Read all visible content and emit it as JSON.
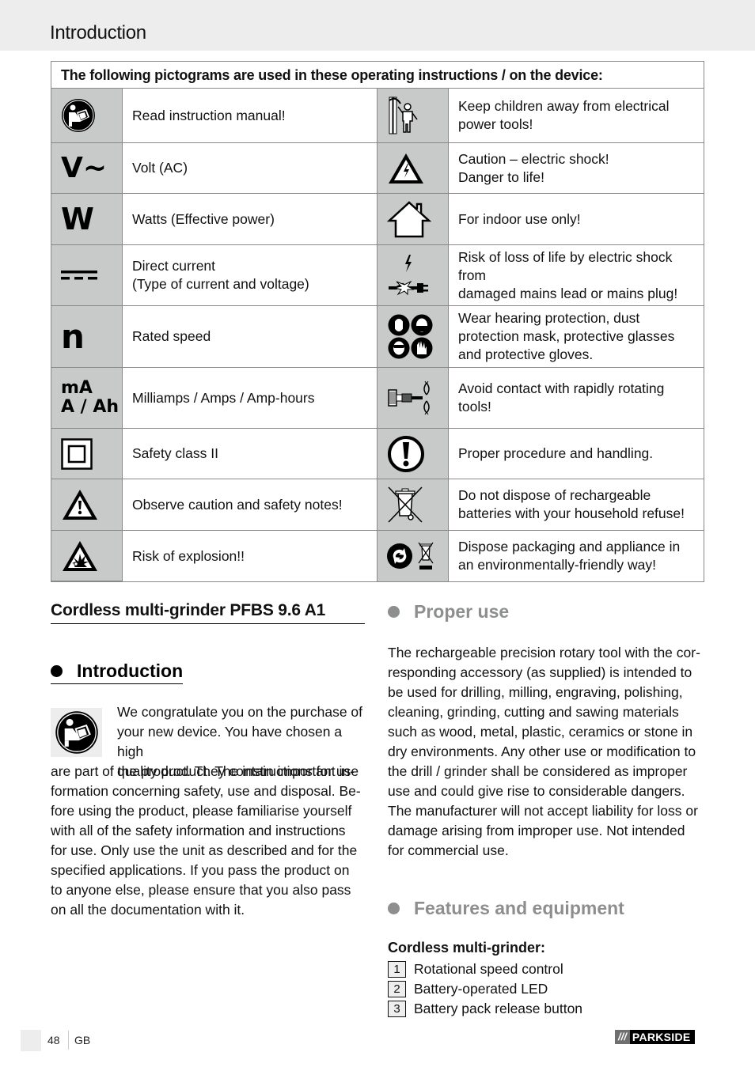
{
  "header": {
    "title": "Introduction"
  },
  "pictogram_table": {
    "caption": "The following pictograms are used in these operating instructions / on the device:",
    "rows": [
      {
        "left": {
          "icon": "read-manual-icon",
          "text": "Read instruction manual!"
        },
        "right": {
          "icon": "keep-children-away-icon",
          "text": "Keep children away from electrical\npower tools!"
        }
      },
      {
        "left": {
          "icon": "volt-ac-symbol",
          "symbol": "V~",
          "text": "Volt (AC)"
        },
        "right": {
          "icon": "electric-shock-warning-icon",
          "text": "Caution – electric shock!\nDanger to life!"
        }
      },
      {
        "left": {
          "icon": "watts-symbol",
          "symbol": "W",
          "text": "Watts (Effective power)"
        },
        "right": {
          "icon": "house-indoor-icon",
          "text": "For indoor use only!"
        }
      },
      {
        "left": {
          "icon": "direct-current-icon",
          "text": "Direct current\n(Type of current and voltage)"
        },
        "right": {
          "icon": "damaged-plug-shock-icon",
          "text": "Risk of loss of life by electric shock from\ndamaged mains lead or mains plug!"
        }
      },
      {
        "left": {
          "icon": "rated-speed-symbol",
          "symbol": "n",
          "text": "Rated speed"
        },
        "right": {
          "icon": "protective-equipment-icon",
          "text": "Wear hearing protection, dust\nprotection mask, protective glasses\nand protective gloves."
        }
      },
      {
        "left": {
          "icon": "amps-symbol",
          "symbol_line1": "mA",
          "symbol_line2": "A / Ah",
          "text": "Milliamps / Amps / Amp-hours"
        },
        "right": {
          "icon": "rotating-tool-icon",
          "text": "Avoid contact with rapidly rotating\ntools!"
        }
      },
      {
        "left": {
          "icon": "safety-class-ii-icon",
          "text": "Safety class II"
        },
        "right": {
          "icon": "exclamation-circle-icon",
          "text": "Proper procedure and handling."
        }
      },
      {
        "left": {
          "icon": "caution-triangle-icon",
          "text": "Observe caution and safety notes!"
        },
        "right": {
          "icon": "crossed-bin-icon",
          "text": "Do not dispose of rechargeable\nbatteries with your household refuse!"
        }
      },
      {
        "left": {
          "icon": "explosion-warning-icon",
          "text": "Risk of explosion!!"
        },
        "right": {
          "icon": "recycle-dispose-icon",
          "text": "Dispose packaging and appliance in\nan environmentally-friendly way!"
        }
      }
    ]
  },
  "left_column": {
    "product_title": "Cordless multi-grinder PFBS 9.6 A1",
    "intro_heading": "Introduction",
    "intro_text_lines": [
      "We congratulate you on the purchase of",
      "your new device. You have chosen a high",
      "quality product. The instructions for use",
      "are part of the product. They contain important in-",
      "formation concerning safety, use and disposal. Be-",
      "fore using the product, please familiarise yourself",
      "with all of the safety information and instructions",
      "for use. Only use the unit as described and for the",
      "specified applications. If you pass the product on",
      "to anyone else, please ensure that you also pass",
      "on all the documentation with it."
    ]
  },
  "right_column": {
    "proper_use_heading": "Proper use",
    "proper_use_lines": [
      "The rechargeable precision rotary tool with the cor-",
      "responding accessory (as supplied) is intended to",
      "be used for drilling, milling, engraving, polishing,",
      "cleaning, grinding, cutting and sawing materials",
      "such as wood, metal, plastic, ceramics or stone in",
      "dry environments. Any other use or modification to",
      "the drill / grinder shall be considered as improper",
      "use and could give rise to considerable dangers.",
      "The manufacturer will not accept liability for loss or",
      "damage arising from improper use. Not intended",
      "for commercial use."
    ],
    "features_heading": "Features and equipment",
    "features_subheading": "Cordless multi-grinder:",
    "features": [
      {
        "num": "1",
        "label": "Rotational speed control"
      },
      {
        "num": "2",
        "label": "Battery-operated LED"
      },
      {
        "num": "3",
        "label": "Battery pack release button"
      }
    ]
  },
  "footer": {
    "page_number": "48",
    "language": "GB",
    "brand_slashes": "///",
    "brand_name": "PARKSIDE"
  },
  "colors": {
    "header_bg": "#ecedec",
    "icon_cell_bg": "#c8c9c9",
    "grey_heading": "#8d8e8e",
    "brand_black": "#000000"
  }
}
